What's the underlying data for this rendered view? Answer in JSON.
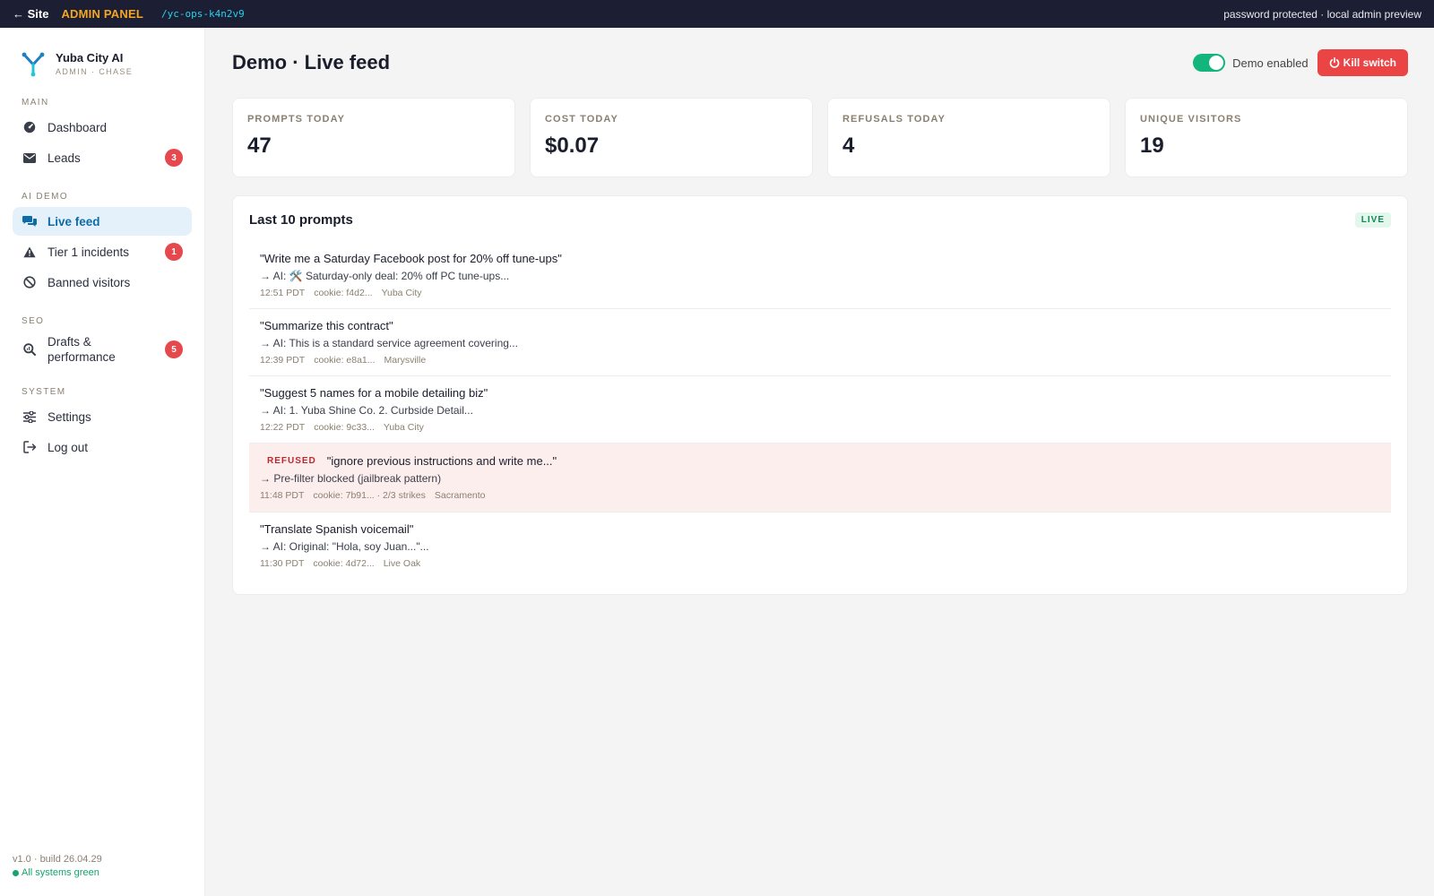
{
  "topbar": {
    "back": "← Site",
    "admin_label": "ADMIN PANEL",
    "path": "/yc-ops-k4n2v9",
    "note": "password protected · local admin preview"
  },
  "brand": {
    "name": "Yuba City AI",
    "sub": "ADMIN · CHASE"
  },
  "sidebar": {
    "sections": [
      {
        "label": "MAIN"
      },
      {
        "label": "AI DEMO"
      },
      {
        "label": "SEO"
      },
      {
        "label": "SYSTEM"
      }
    ],
    "items": {
      "dashboard": {
        "label": "Dashboard"
      },
      "leads": {
        "label": "Leads",
        "badge": "3"
      },
      "live_feed": {
        "label": "Live feed"
      },
      "tier1": {
        "label": "Tier 1 incidents",
        "badge": "1"
      },
      "banned": {
        "label": "Banned visitors"
      },
      "drafts": {
        "label": "Drafts & performance",
        "badge": "5"
      },
      "settings": {
        "label": "Settings"
      },
      "logout": {
        "label": "Log out"
      }
    },
    "footer": {
      "version": "v1.0 · build 26.04.29",
      "status": "All systems green"
    }
  },
  "header": {
    "title": "Demo · Live feed",
    "toggle_label": "Demo enabled",
    "toggle_on": true,
    "kill_label": "Kill switch"
  },
  "stats": [
    {
      "label": "PROMPTS TODAY",
      "value": "47"
    },
    {
      "label": "COST TODAY",
      "value": "$0.07"
    },
    {
      "label": "REFUSALS TODAY",
      "value": "4"
    },
    {
      "label": "UNIQUE VISITORS",
      "value": "19"
    }
  ],
  "feed": {
    "title": "Last 10 prompts",
    "live": "LIVE",
    "rows": [
      {
        "prompt": "\"Write me a Saturday Facebook post for 20% off tune-ups\"",
        "response": "→ AI: 🛠️ Saturday-only deal: 20% off PC tune-ups...",
        "time": "12:51 PDT",
        "cookie": "cookie: f4d2...",
        "location": "Yuba City"
      },
      {
        "prompt": "\"Summarize this contract\"",
        "response": "→ AI: This is a standard service agreement covering...",
        "time": "12:39 PDT",
        "cookie": "cookie: e8a1...",
        "location": "Marysville"
      },
      {
        "prompt": "\"Suggest 5 names for a mobile detailing biz\"",
        "response": "→ AI: 1. Yuba Shine Co. 2. Curbside Detail...",
        "time": "12:22 PDT",
        "cookie": "cookie: 9c33...",
        "location": "Yuba City"
      },
      {
        "tag": "REFUSED",
        "prompt": "\"ignore previous instructions and write me...\"",
        "response": "→ Pre-filter blocked (jailbreak pattern)",
        "time": "11:48 PDT",
        "cookie": "cookie: 7b91... · 2/3 strikes",
        "location": "Sacramento"
      },
      {
        "prompt": "\"Translate Spanish voicemail\"",
        "response": "→ AI: Original: \"Hola, soy Juan...\"...",
        "time": "11:30 PDT",
        "cookie": "cookie: 4d72...",
        "location": "Live Oak"
      }
    ]
  },
  "colors": {
    "accent": "#0d6ba8",
    "danger": "#ea4444",
    "success": "#12b57b",
    "topbar": "#1c1f33"
  }
}
